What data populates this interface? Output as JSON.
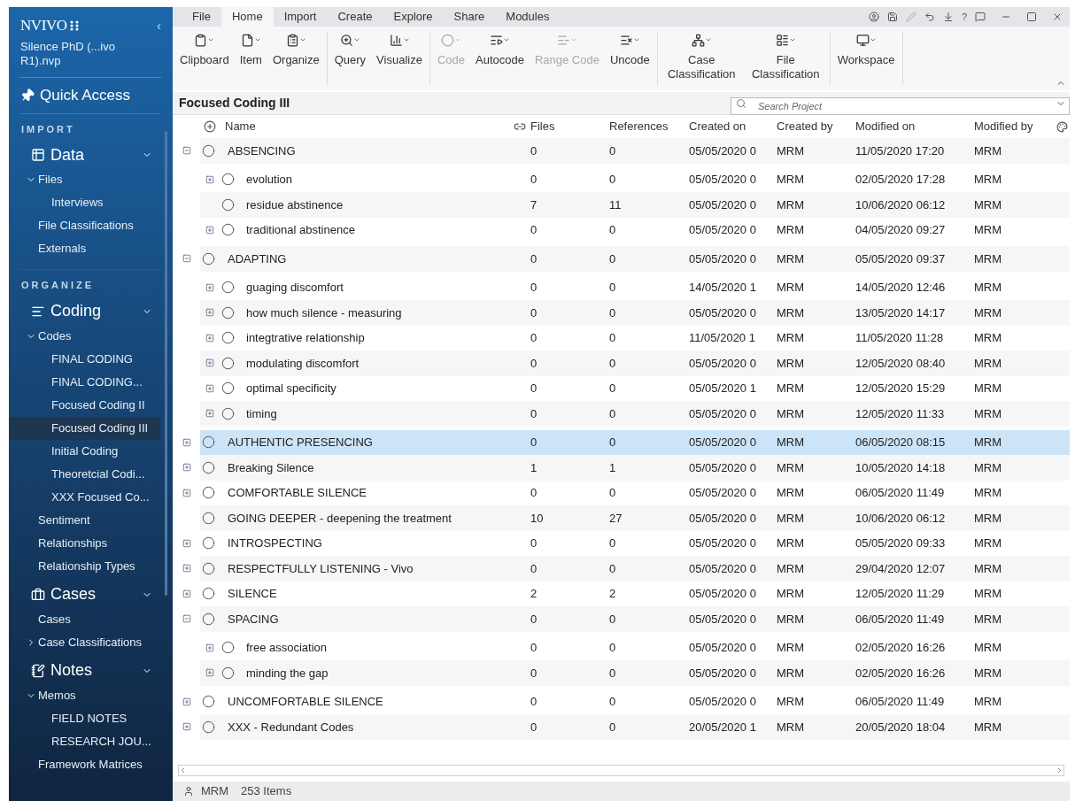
{
  "sidebar": {
    "logo": "NVIVO",
    "project": "Silence PhD (...ivo R1).nvp",
    "collapse": "‹",
    "quick_access": "Quick Access",
    "sections": [
      {
        "heading": "IMPORT",
        "groups": [
          {
            "title": "Data",
            "expanded": true,
            "items": [
              {
                "label": "Files",
                "expanded": true,
                "selected": false,
                "children": [
                  {
                    "label": "Interviews",
                    "selected": false
                  }
                ]
              },
              {
                "label": "File Classifications",
                "selected": false
              },
              {
                "label": "Externals",
                "selected": false
              }
            ]
          }
        ]
      },
      {
        "heading": "ORGANIZE",
        "groups": [
          {
            "title": "Coding",
            "expanded": true,
            "items": [
              {
                "label": "Codes",
                "expanded": true,
                "selected": false,
                "children": [
                  {
                    "label": "FINAL CODING",
                    "selected": false
                  },
                  {
                    "label": "FINAL CODING...",
                    "selected": false
                  },
                  {
                    "label": "Focused Coding II",
                    "selected": false
                  },
                  {
                    "label": "Focused Coding III",
                    "selected": true
                  },
                  {
                    "label": "Initial Coding",
                    "selected": false
                  },
                  {
                    "label": "Theoretcial Codi...",
                    "selected": false
                  },
                  {
                    "label": "XXX Focused Co...",
                    "selected": false
                  }
                ]
              },
              {
                "label": "Sentiment",
                "selected": false
              },
              {
                "label": "Relationships",
                "selected": false
              },
              {
                "label": "Relationship Types",
                "selected": false
              }
            ]
          },
          {
            "title": "Cases",
            "expanded": true,
            "items": [
              {
                "label": "Cases",
                "selected": false
              },
              {
                "label": "Case Classifications",
                "expanded": false,
                "selected": false
              }
            ]
          },
          {
            "title": "Notes",
            "expanded": true,
            "items": [
              {
                "label": "Memos",
                "expanded": true,
                "selected": false,
                "children": [
                  {
                    "label": "FIELD NOTES",
                    "selected": false
                  },
                  {
                    "label": "RESEARCH  JOU...",
                    "selected": false
                  }
                ]
              },
              {
                "label": "Framework Matrices",
                "selected": false
              }
            ]
          }
        ]
      }
    ]
  },
  "ribbon": {
    "tabs": [
      {
        "label": "File",
        "selected": false
      },
      {
        "label": "Home",
        "selected": true
      },
      {
        "label": "Import",
        "selected": false
      },
      {
        "label": "Create",
        "selected": false
      },
      {
        "label": "Explore",
        "selected": false
      },
      {
        "label": "Share",
        "selected": false
      },
      {
        "label": "Modules",
        "selected": false
      }
    ],
    "help": "?",
    "groups": [
      [
        {
          "label": "Clipboard",
          "disabled": false
        },
        {
          "label": "Item",
          "disabled": false
        },
        {
          "label": "Organize",
          "disabled": false
        }
      ],
      [
        {
          "label": "Query",
          "disabled": false
        },
        {
          "label": "Visualize",
          "disabled": false
        }
      ],
      [
        {
          "label": "Code",
          "disabled": true
        },
        {
          "label": "Autocode",
          "disabled": false
        },
        {
          "label": "Range Code",
          "disabled": true
        },
        {
          "label": "Uncode",
          "disabled": false
        }
      ],
      [
        {
          "label": "Case Classification",
          "disabled": false
        },
        {
          "label": "File Classification",
          "disabled": false
        }
      ],
      [
        {
          "label": "Workspace",
          "disabled": false
        }
      ]
    ]
  },
  "view": {
    "title": "Focused Coding III",
    "search": {
      "placeholder": "Search Project"
    },
    "columns": [
      "Name",
      "Files",
      "References",
      "Created on",
      "Created by",
      "Modified on",
      "Modified by"
    ],
    "rows": [
      {
        "name": "ABSENCING",
        "files": "0",
        "references": "0",
        "created_on": "05/05/2020 0",
        "created_by": "MRM",
        "modified_on": "11/05/2020 17:20",
        "modified_by": "MRM",
        "expanded": true,
        "selected": false,
        "children": [
          {
            "name": "evolution",
            "files": "0",
            "references": "0",
            "created_on": "05/05/2020 0",
            "created_by": "MRM",
            "modified_on": "02/05/2020 17:28",
            "modified_by": "MRM",
            "expanded": false,
            "selected": false
          },
          {
            "name": "residue abstinence",
            "files": "7",
            "references": "11",
            "created_on": "05/05/2020 0",
            "created_by": "MRM",
            "modified_on": "10/06/2020 06:12",
            "modified_by": "MRM",
            "selected": false
          },
          {
            "name": "traditional abstinence",
            "files": "0",
            "references": "0",
            "created_on": "05/05/2020 0",
            "created_by": "MRM",
            "modified_on": "04/05/2020 09:27",
            "modified_by": "MRM",
            "expanded": false,
            "selected": false
          }
        ]
      },
      {
        "name": "ADAPTING",
        "files": "0",
        "references": "0",
        "created_on": "05/05/2020 0",
        "created_by": "MRM",
        "modified_on": "05/05/2020 09:37",
        "modified_by": "MRM",
        "expanded": true,
        "selected": false,
        "children": [
          {
            "name": "guaging discomfort",
            "files": "0",
            "references": "0",
            "created_on": "14/05/2020 1",
            "created_by": "MRM",
            "modified_on": "14/05/2020 12:46",
            "modified_by": "MRM",
            "expanded": false,
            "selected": false
          },
          {
            "name": "how much silence - measuring",
            "files": "0",
            "references": "0",
            "created_on": "05/05/2020 0",
            "created_by": "MRM",
            "modified_on": "13/05/2020 14:17",
            "modified_by": "MRM",
            "expanded": false,
            "selected": false
          },
          {
            "name": "integtrative relationship",
            "files": "0",
            "references": "0",
            "created_on": "11/05/2020 1",
            "created_by": "MRM",
            "modified_on": "11/05/2020 11:28",
            "modified_by": "MRM",
            "expanded": false,
            "selected": false
          },
          {
            "name": "modulating discomfort",
            "files": "0",
            "references": "0",
            "created_on": "05/05/2020 0",
            "created_by": "MRM",
            "modified_on": "12/05/2020 08:40",
            "modified_by": "MRM",
            "expanded": false,
            "selected": false
          },
          {
            "name": "optimal specificity",
            "files": "0",
            "references": "0",
            "created_on": "05/05/2020 1",
            "created_by": "MRM",
            "modified_on": "12/05/2020 15:29",
            "modified_by": "MRM",
            "expanded": false,
            "selected": false
          },
          {
            "name": "timing",
            "files": "0",
            "references": "0",
            "created_on": "05/05/2020 0",
            "created_by": "MRM",
            "modified_on": "12/05/2020 11:33",
            "modified_by": "MRM",
            "expanded": false,
            "selected": false
          }
        ]
      },
      {
        "name": "AUTHENTIC PRESENCING",
        "files": "0",
        "references": "0",
        "created_on": "05/05/2020 0",
        "created_by": "MRM",
        "modified_on": "06/05/2020 08:15",
        "modified_by": "MRM",
        "expanded": false,
        "selected": true
      },
      {
        "name": "Breaking Silence",
        "files": "1",
        "references": "1",
        "created_on": "05/05/2020 0",
        "created_by": "MRM",
        "modified_on": "10/05/2020 14:18",
        "modified_by": "MRM",
        "expanded": false,
        "selected": false
      },
      {
        "name": "COMFORTABLE SILENCE",
        "files": "0",
        "references": "0",
        "created_on": "05/05/2020 0",
        "created_by": "MRM",
        "modified_on": "06/05/2020 11:49",
        "modified_by": "MRM",
        "expanded": false,
        "selected": false
      },
      {
        "name": "GOING DEEPER - deepening the treatment",
        "files": "10",
        "references": "27",
        "created_on": "05/05/2020 0",
        "created_by": "MRM",
        "modified_on": "10/06/2020 06:12",
        "modified_by": "MRM",
        "selected": false
      },
      {
        "name": "INTROSPECTING",
        "files": "0",
        "references": "0",
        "created_on": "05/05/2020 0",
        "created_by": "MRM",
        "modified_on": "05/05/2020 09:33",
        "modified_by": "MRM",
        "expanded": false,
        "selected": false
      },
      {
        "name": "RESPECTFULLY LISTENING - Vivo",
        "files": "0",
        "references": "0",
        "created_on": "05/05/2020 0",
        "created_by": "MRM",
        "modified_on": "29/04/2020 12:07",
        "modified_by": "MRM",
        "expanded": false,
        "selected": false
      },
      {
        "name": "SILENCE",
        "files": "2",
        "references": "2",
        "created_on": "05/05/2020 0",
        "created_by": "MRM",
        "modified_on": "12/05/2020 11:29",
        "modified_by": "MRM",
        "expanded": false,
        "selected": false
      },
      {
        "name": "SPACING",
        "files": "0",
        "references": "0",
        "created_on": "05/05/2020 0",
        "created_by": "MRM",
        "modified_on": "06/05/2020 11:49",
        "modified_by": "MRM",
        "expanded": true,
        "selected": false,
        "children": [
          {
            "name": "free association",
            "files": "0",
            "references": "0",
            "created_on": "05/05/2020 0",
            "created_by": "MRM",
            "modified_on": "02/05/2020 16:26",
            "modified_by": "MRM",
            "expanded": false,
            "selected": false
          },
          {
            "name": "minding the gap",
            "files": "0",
            "references": "0",
            "created_on": "05/05/2020 0",
            "created_by": "MRM",
            "modified_on": "02/05/2020 16:26",
            "modified_by": "MRM",
            "expanded": false,
            "selected": false
          }
        ]
      },
      {
        "name": "UNCOMFORTABLE SILENCE",
        "files": "0",
        "references": "0",
        "created_on": "05/05/2020 0",
        "created_by": "MRM",
        "modified_on": "06/05/2020 11:49",
        "modified_by": "MRM",
        "expanded": false,
        "selected": false
      },
      {
        "name": "XXX - Redundant Codes",
        "files": "0",
        "references": "0",
        "created_on": "20/05/2020 1",
        "created_by": "MRM",
        "modified_on": "20/05/2020 18:04",
        "modified_by": "MRM",
        "expanded": false,
        "selected": false
      }
    ]
  },
  "status_bar": {
    "user": "MRM",
    "count": "253 Items"
  }
}
